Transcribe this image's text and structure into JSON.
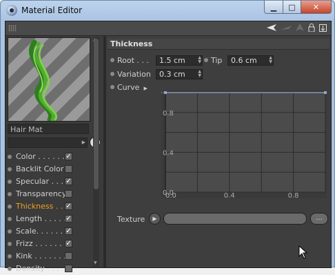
{
  "window": {
    "title": "Material Editor",
    "close_glyph": "✕",
    "minimize_glyph": "▁",
    "maximize_glyph": "□"
  },
  "toolbar": {
    "icons": [
      "arrow-left-icon",
      "arrow-right-icon",
      "up-arrow-icon",
      "lock-icon",
      "new-window-icon"
    ]
  },
  "material": {
    "name": "Hair Mat"
  },
  "channels": [
    {
      "label": "Color . . . . . .",
      "checked": true
    },
    {
      "label": "Backlit Color",
      "checked": false
    },
    {
      "label": "Specular . . . .",
      "checked": true
    },
    {
      "label": "Transparency",
      "checked": false
    },
    {
      "label": "Thickness . . .",
      "checked": true,
      "active": true
    },
    {
      "label": "Length . . . . .",
      "checked": true
    },
    {
      "label": "Scale. . . . . . .",
      "checked": true
    },
    {
      "label": "Frizz . . . . . . .",
      "checked": true
    },
    {
      "label": "Kink . . . . . . .",
      "checked": false
    },
    {
      "label": "Density . . . .",
      "checked": false
    }
  ],
  "thickness": {
    "header": "Thickness",
    "root_label": "Root . . .",
    "root_value": "1.5 cm",
    "tip_label": "Tip",
    "tip_value": "0.6 cm",
    "variation_label": "Variation",
    "variation_value": "0.3 cm",
    "curve_label": "Curve",
    "texture_label": "Texture",
    "texture_more": "..."
  },
  "chart_data": {
    "type": "line",
    "x": [
      0.0,
      1.0
    ],
    "series": [
      {
        "values": [
          1.0,
          1.0
        ]
      }
    ],
    "xlim": [
      0.0,
      1.0
    ],
    "ylim": [
      0.0,
      1.0
    ],
    "x_ticks": [
      "0.0",
      "0.4",
      "0.8"
    ],
    "y_ticks": [
      "0.8",
      "0.4",
      "0.0"
    ],
    "grid": true,
    "colors": {
      "line": "#8fa8d0",
      "grid": "#2c2c2c",
      "bg": "#4b4b4b"
    }
  }
}
